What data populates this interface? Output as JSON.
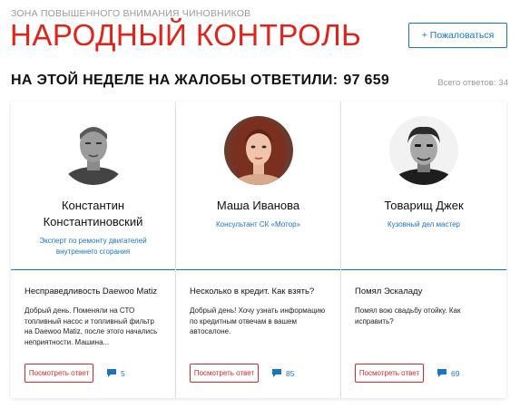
{
  "header": {
    "eyebrow": "ЗОНА ПОВЫШЕННОГО ВНИМАНИЯ ЧИНОВНИКОВ",
    "title": "НАРОДНЫЙ КОНТРОЛЬ",
    "complain_button": "+ Пожаловаться"
  },
  "stats": {
    "week_label": "НА ЭТОЙ НЕДЕЛЕ НА ЖАЛОБЫ ОТВЕТИЛИ:",
    "week_count": "97 659",
    "total_label": "Всего ответов:",
    "total_count": "34"
  },
  "colors": {
    "accent_red": "#e2231a",
    "link_blue": "#1a74c4"
  },
  "cards": [
    {
      "name": "Константин Константиновский",
      "role": "Эксперт по ремонту двигателей внутреннего сгорания",
      "complaint_title": "Несправедливость Daewoo Matiz",
      "complaint_text": "Добрый день. Поменяли на СТО топливный насос и топливный фильтр на Daewoo Matiz, после этого начались неприятности. Машина...",
      "answer_button": "Посмотреть ответ",
      "comment_icon": "comment-icon",
      "comments": "5"
    },
    {
      "name": "Маша Иванова",
      "role": "Консультант СК «Мотор»",
      "complaint_title": "Несколько в кредит. Как взять?",
      "complaint_text": "Добрый день! Хочу узнать информацию по кредитным отвечам в вашем автосалоне.",
      "answer_button": "Посмотреть ответ",
      "comment_icon": "comment-icon",
      "comments": "85"
    },
    {
      "name": "Товарищ Джек",
      "role": "Кузовный дел мастер",
      "complaint_title": "Помял Эскаладу",
      "complaint_text": "Помял вою свадьбу отойку. Как исправить?",
      "answer_button": "Посмотреть ответ",
      "comment_icon": "comment-icon",
      "comments": "69"
    }
  ]
}
